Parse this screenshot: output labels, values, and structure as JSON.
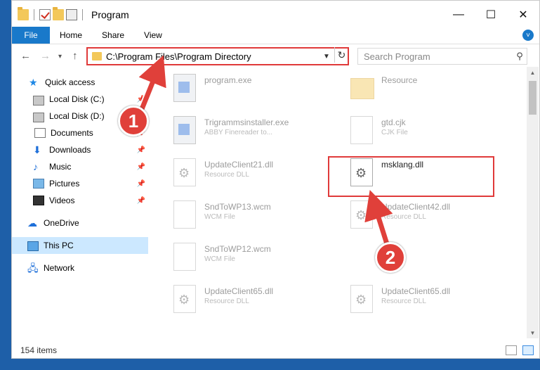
{
  "window": {
    "title": "Program",
    "controls": {
      "minimize": "—",
      "maximize": "☐",
      "close": "✕"
    }
  },
  "ribbon": {
    "tabs": [
      {
        "label": "File"
      },
      {
        "label": "Home"
      },
      {
        "label": "Share"
      },
      {
        "label": "View"
      }
    ]
  },
  "nav": {
    "back": "←",
    "forward": "→",
    "recent": "▾",
    "up": "↑",
    "address": "C:\\Program Files\\Program Directory",
    "refresh": "↻",
    "search_placeholder": "Search Program"
  },
  "sidebar": {
    "items": [
      {
        "label": "Quick access",
        "icon": "star-icon"
      },
      {
        "label": "Local Disk (C:)",
        "icon": "disk-icon"
      },
      {
        "label": "Local Disk (D:)",
        "icon": "disk-icon"
      },
      {
        "label": "Documents",
        "icon": "documents-icon"
      },
      {
        "label": "Downloads",
        "icon": "downloads-icon"
      },
      {
        "label": "Music",
        "icon": "music-icon"
      },
      {
        "label": "Pictures",
        "icon": "pictures-icon"
      },
      {
        "label": "Videos",
        "icon": "videos-icon"
      },
      {
        "label": "OneDrive",
        "icon": "onedrive-icon"
      },
      {
        "label": "This PC",
        "icon": "this-pc-icon"
      },
      {
        "label": "Network",
        "icon": "network-icon"
      }
    ]
  },
  "files": [
    {
      "name": "program.exe",
      "type": ""
    },
    {
      "name": "Resource",
      "type": ""
    },
    {
      "name": "Trigrammsinstaller.exe",
      "type": "ABBY Finereader to..."
    },
    {
      "name": "gtd.cjk",
      "type": "CJK File"
    },
    {
      "name": "UpdateClient21.dll",
      "type": "Resource DLL"
    },
    {
      "name": "msklang.dll",
      "type": ""
    },
    {
      "name": "SndToWP13.wcm",
      "type": "WCM File"
    },
    {
      "name": "UpdateClient42.dll",
      "type": "Resource DLL"
    },
    {
      "name": "SndToWP12.wcm",
      "type": "WCM File"
    },
    {
      "name": "UpdateClient65.dll",
      "type": "Resource DLL"
    },
    {
      "name": "UpdateClient65.dll",
      "type": "Resource DLL"
    }
  ],
  "status": {
    "items_count": "154 items"
  },
  "annotations": {
    "step1": "1",
    "step2": "2"
  },
  "colors": {
    "accent": "#1979ca",
    "highlight": "#e03a3a",
    "selected": "#cce8ff"
  }
}
